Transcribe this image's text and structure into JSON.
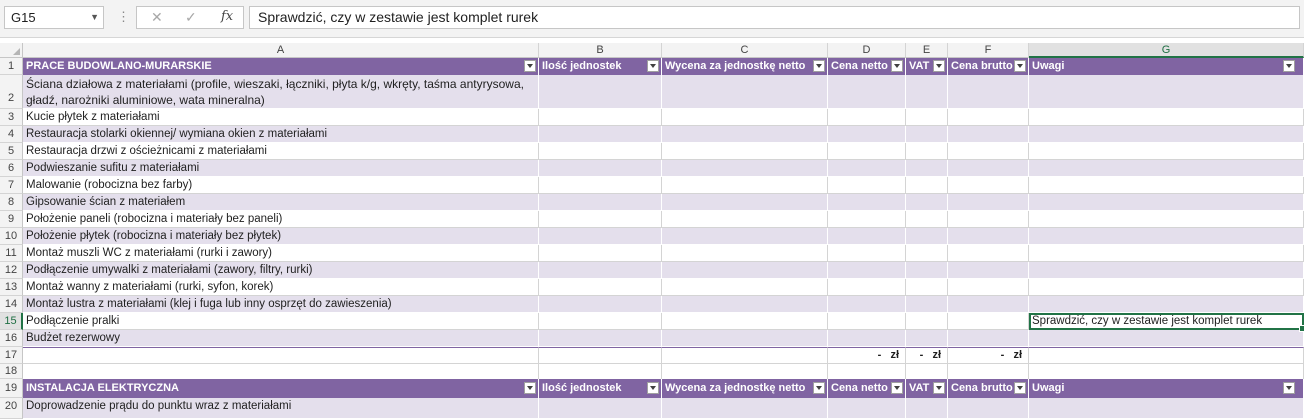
{
  "name_box": "G15",
  "formula_content": "Sprawdzić, czy w zestawie jest komplet rurek",
  "columns": [
    "A",
    "B",
    "C",
    "D",
    "E",
    "F",
    "G"
  ],
  "row_numbers": [
    "1",
    "2",
    "3",
    "4",
    "5",
    "6",
    "7",
    "8",
    "9",
    "10",
    "11",
    "12",
    "13",
    "14",
    "15",
    "16",
    "17",
    "18",
    "19",
    "20"
  ],
  "header_cells": [
    "PRACE BUDOWLANO-MURARSKIE",
    "Ilość jednostek",
    "Wycena za jednostkę netto",
    "Cena netto",
    "VAT",
    "Cena brutto",
    "Uwagi"
  ],
  "items": [
    "Ściana działowa z materiałami (profile, wieszaki, łączniki, płyta k/g, wkręty, taśma antyrysowa, gładź, narożniki aluminiowe, wata mineralna)",
    "Kucie płytek z materiałami",
    "Restauracja stolarki okiennej/ wymiana okien z materiałami",
    "Restauracja drzwi z ościeżnicami z materiałami",
    "Podwieszanie sufitu  z materiałami",
    "Malowanie (robocizna bez farby)",
    "Gipsowanie ścian z materiałem",
    "Położenie paneli (robocizna i materiały bez paneli)",
    "Położenie płytek (robocizna i materiały bez płytek)",
    "Montaż muszli WC z materiałami (rurki i zawory)",
    "Podłączenie umywalki z materiałami (zawory, filtry, rurki)",
    "Montaż wanny z materiałami (rurki, syfon, korek)",
    "Montaż lustra z materiałami (klej i fuga lub inny osprzęt do zawieszenia)",
    "Podłączenie pralki",
    "Budżet rezerwowy"
  ],
  "note_g15": "Sprawdzić, czy w zestawie jest komplet rurek",
  "totals": {
    "d": "-   zł",
    "e": "-   zł",
    "f": "-   zł"
  },
  "header2_cells": [
    "INSTALACJA ELEKTRYCZNA",
    "Ilość jednostek",
    "Wycena za jednostkę netto",
    "Cena netto",
    "VAT",
    "Cena brutto",
    "Uwagi"
  ],
  "row20": "Doprowadzenie prądu do punktu wraz z materiałami",
  "colors": {
    "header_bg": "#8064a2",
    "band_bg": "#e4dfec",
    "selection": "#217346"
  }
}
